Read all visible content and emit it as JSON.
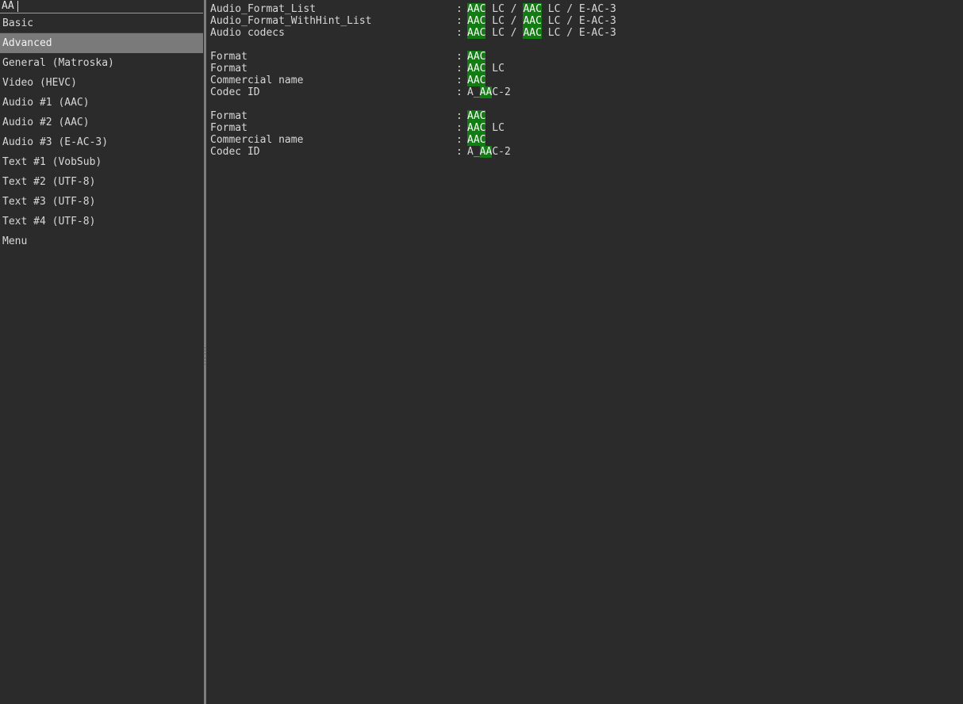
{
  "search": {
    "value": "AA",
    "placeholder": ""
  },
  "sidebar": {
    "items": [
      {
        "label": "Basic",
        "selected": false,
        "header": true
      },
      {
        "label": "Advanced",
        "selected": true,
        "header": false
      },
      {
        "label": "General (Matroska)",
        "selected": false,
        "header": false
      },
      {
        "label": "Video (HEVC)",
        "selected": false,
        "header": false
      },
      {
        "label": "Audio #1 (AAC)",
        "selected": false,
        "header": false
      },
      {
        "label": "Audio #2 (AAC)",
        "selected": false,
        "header": false
      },
      {
        "label": "Audio #3 (E-AC-3)",
        "selected": false,
        "header": false
      },
      {
        "label": "Text #1 (VobSub)",
        "selected": false,
        "header": false
      },
      {
        "label": "Text #2 (UTF-8)",
        "selected": false,
        "header": false
      },
      {
        "label": "Text #3 (UTF-8)",
        "selected": false,
        "header": false
      },
      {
        "label": "Text #4 (UTF-8)",
        "selected": false,
        "header": false
      },
      {
        "label": "Menu",
        "selected": false,
        "header": false
      }
    ]
  },
  "colors": {
    "background": "#2b2b2b",
    "text": "#d8d8d8",
    "selection": "#7a7a7a",
    "highlight": "#107d10",
    "splitter": "#7e7e7e"
  },
  "content": {
    "blocks": [
      {
        "rows": [
          {
            "key": "Audio_Format_List",
            "sep": ":",
            "parts": [
              {
                "t": "AAC",
                "h": true
              },
              {
                "t": " LC / ",
                "h": false
              },
              {
                "t": "AAC",
                "h": true
              },
              {
                "t": " LC / E-AC-3",
                "h": false
              }
            ]
          },
          {
            "key": "Audio_Format_WithHint_List",
            "sep": ":",
            "parts": [
              {
                "t": "AAC",
                "h": true
              },
              {
                "t": " LC / ",
                "h": false
              },
              {
                "t": "AAC",
                "h": true
              },
              {
                "t": " LC / E-AC-3",
                "h": false
              }
            ]
          },
          {
            "key": "Audio codecs",
            "sep": ":",
            "parts": [
              {
                "t": "AAC",
                "h": true
              },
              {
                "t": " LC / ",
                "h": false
              },
              {
                "t": "AAC",
                "h": true
              },
              {
                "t": " LC / E-AC-3",
                "h": false
              }
            ]
          }
        ]
      },
      {
        "rows": [
          {
            "key": "Format",
            "sep": ":",
            "parts": [
              {
                "t": "AAC",
                "h": true
              }
            ]
          },
          {
            "key": "Format",
            "sep": ":",
            "parts": [
              {
                "t": "AAC",
                "h": true
              },
              {
                "t": " LC",
                "h": false
              }
            ]
          },
          {
            "key": "Commercial name",
            "sep": ":",
            "parts": [
              {
                "t": "AAC",
                "h": true
              }
            ]
          },
          {
            "key": "Codec ID",
            "sep": ":",
            "parts": [
              {
                "t": "A_",
                "h": false
              },
              {
                "t": "AA",
                "h": true
              },
              {
                "t": "C-2",
                "h": false
              }
            ]
          }
        ]
      },
      {
        "rows": [
          {
            "key": "Format",
            "sep": ":",
            "parts": [
              {
                "t": "AAC",
                "h": true
              }
            ]
          },
          {
            "key": "Format",
            "sep": ":",
            "parts": [
              {
                "t": "AAC",
                "h": true
              },
              {
                "t": " LC",
                "h": false
              }
            ]
          },
          {
            "key": "Commercial name",
            "sep": ":",
            "parts": [
              {
                "t": "AAC",
                "h": true
              }
            ]
          },
          {
            "key": "Codec ID",
            "sep": ":",
            "parts": [
              {
                "t": "A_",
                "h": false
              },
              {
                "t": "AA",
                "h": true
              },
              {
                "t": "C-2",
                "h": false
              }
            ]
          }
        ]
      }
    ]
  }
}
